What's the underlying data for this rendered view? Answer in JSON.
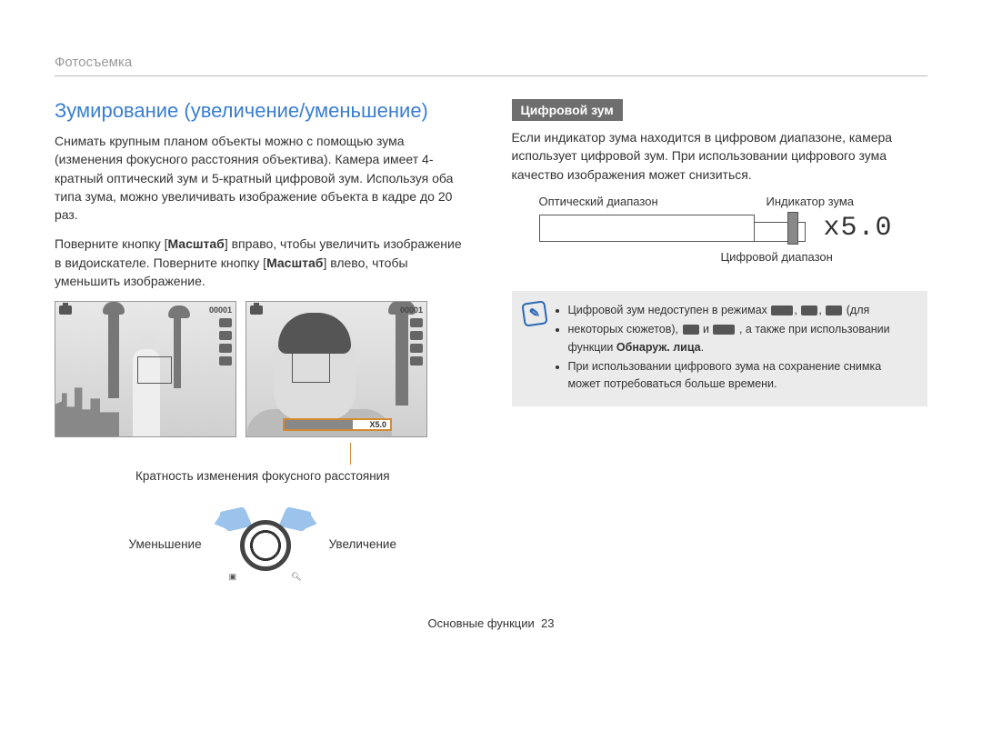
{
  "header": "Фотосъемка",
  "left": {
    "title": "Зумирование (увеличение/уменьшение)",
    "para1": "Снимать крупным планом объекты можно с помощью зума (изменения фокусного расстояния объектива). Камера имеет 4-кратный оптический зум и 5-кратный цифровой зум. Используя оба типа зума, можно увеличивать изображение объекта в кадре до 20 раз.",
    "para2_a": "Поверните кнопку [",
    "para2_bold1": "Масштаб",
    "para2_b": "] вправо, чтобы увеличить изображение в видоискателе. Поверните кнопку [",
    "para2_bold2": "Масштаб",
    "para2_c": "] влево, чтобы уменьшить изображение.",
    "vf_counter": "00001",
    "vf_zoom_text": "X5.0",
    "caption_zoom": "Кратность изменения фокусного расстояния",
    "dial_left": "Уменьшение",
    "dial_right": "Увеличение"
  },
  "right": {
    "subhead": "Цифровой зум",
    "para1": "Если индикатор зума находится в цифровом диапазоне, камера использует цифровой зум. При использовании цифрового зума качество изображения может снизиться.",
    "label_optical": "Оптический диапазон",
    "label_indicator": "Индикатор зума",
    "label_digital": "Цифровой диапазон",
    "zoom_value": "x5.0",
    "note": {
      "li1_a": "Цифровой зум недоступен в режимах ",
      "li1_b": " (для",
      "li2_a": "некоторых сюжетов), ",
      "li2_b": " и ",
      "li2_c": ", а также при использовании функции ",
      "li2_bold": "Обнаруж. лица",
      "li2_d": ".",
      "li3": "При использовании цифрового зума на сохранение снимка может потребоваться больше времени."
    }
  },
  "footer": {
    "section": "Основные функции",
    "page": "23"
  }
}
